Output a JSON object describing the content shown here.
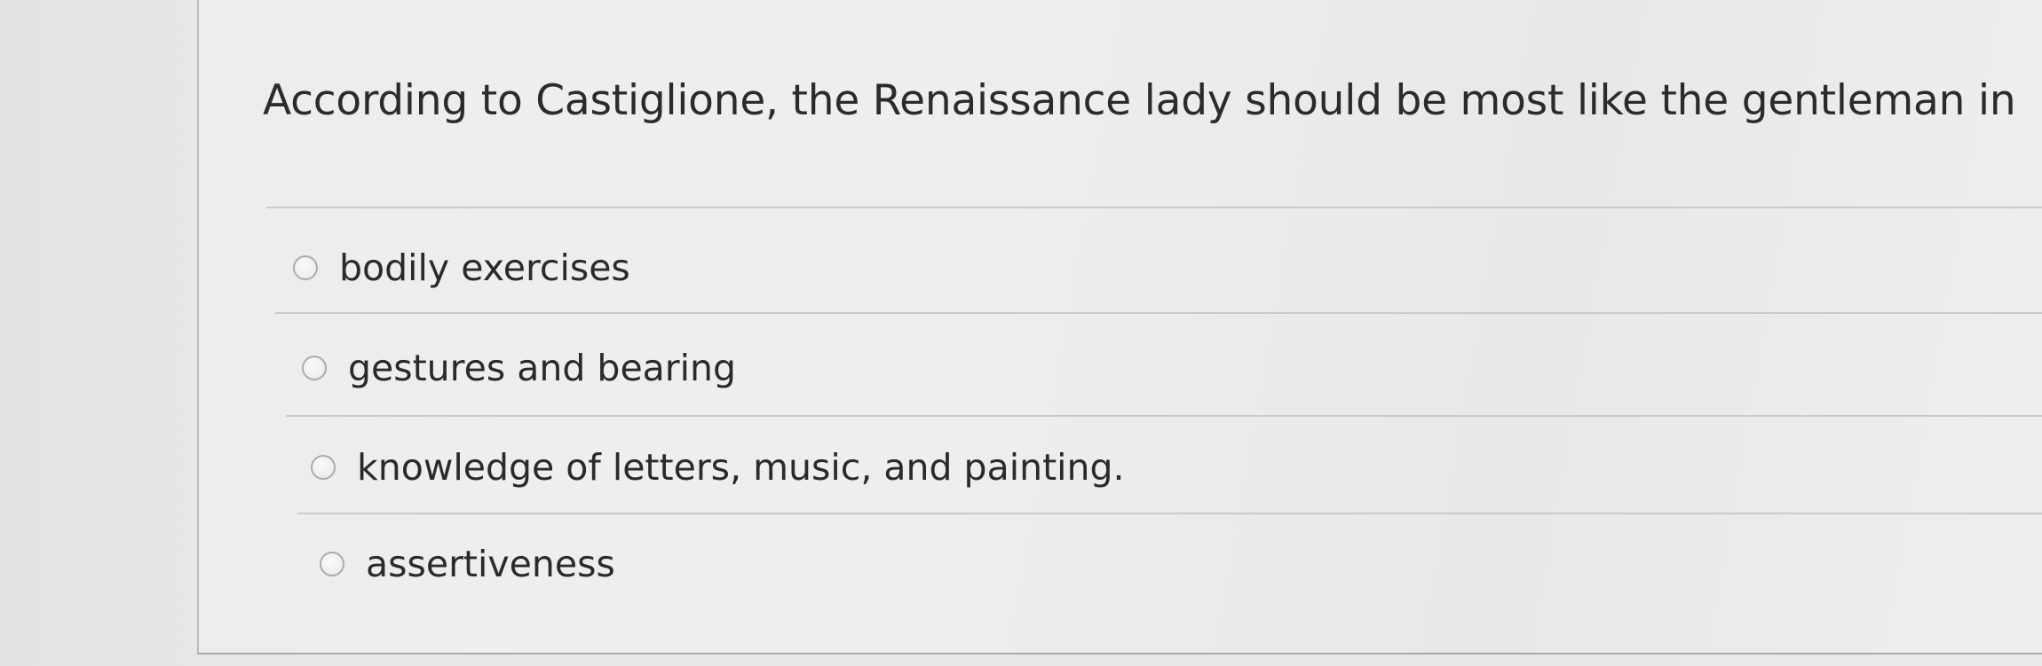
{
  "question": {
    "text": "According to Castiglione, the Renaissance lady should be most like the gentleman in"
  },
  "answers": [
    {
      "label": "bodily exercises",
      "selected": false
    },
    {
      "label": "gestures and bearing",
      "selected": false
    },
    {
      "label": "knowledge of letters, music, and painting.",
      "selected": false
    },
    {
      "label": "assertiveness",
      "selected": false
    }
  ]
}
